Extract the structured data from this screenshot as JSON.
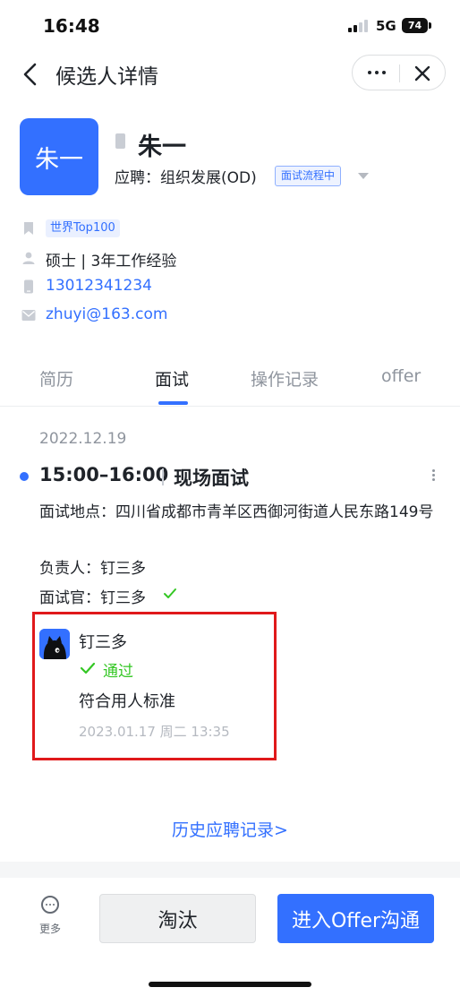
{
  "status_bar": {
    "time": "16:48",
    "network": "5G",
    "battery": "74"
  },
  "nav": {
    "title": "候选人详情"
  },
  "candidate": {
    "avatar_text": "朱一",
    "name": "朱一",
    "apply_label": "应聘：组织发展(OD)",
    "stage_tag": "面试流程中",
    "tag": "世界Top100",
    "education": "硕士 | 3年工作经验",
    "phone": "13012341234",
    "email": "zhuyi@163.com"
  },
  "tabs": [
    {
      "label": "简历"
    },
    {
      "label": "面试"
    },
    {
      "label": "操作记录"
    },
    {
      "label": "offer"
    }
  ],
  "active_tab": "面试",
  "interview": {
    "date": "2022.12.19",
    "time": "15:00–16:00",
    "type": "现场面试",
    "location": "面试地点：四川省成都市青羊区西御河街道人民东路149号",
    "owner": "负责人：钉三多",
    "interviewer": "面试官：钉三多",
    "feedback": {
      "name": "钉三多",
      "result": "通过",
      "comment": "符合用人标准",
      "time": "2023.01.17 周二 13:35"
    }
  },
  "history_link": "历史应聘记录>",
  "bottom": {
    "more_label": "更多",
    "reject_label": "淘汰",
    "offer_label": "进入Offer沟通"
  },
  "colors": {
    "accent": "#3370ff",
    "success": "#34c724",
    "highlight": "#e0191b"
  }
}
